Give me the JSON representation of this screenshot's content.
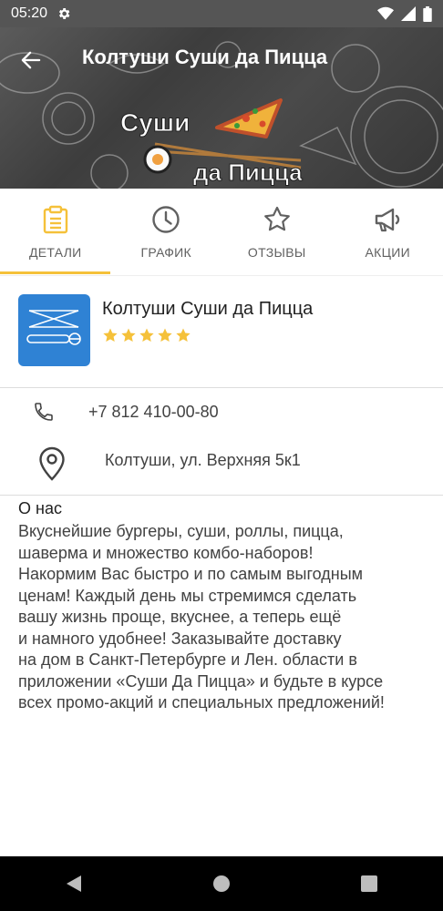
{
  "status_bar": {
    "time": "05:20"
  },
  "header": {
    "title": "Колтуши Суши да Пицца",
    "logo_line1": "Суши",
    "logo_line2": "да Пицца"
  },
  "tabs": [
    {
      "label": "ДЕТАЛИ",
      "icon": "clipboard-icon",
      "active": true
    },
    {
      "label": "ГРАФИК",
      "icon": "clock-icon",
      "active": false
    },
    {
      "label": "ОТЗЫВЫ",
      "icon": "star-outline-icon",
      "active": false
    },
    {
      "label": "АКЦИИ",
      "icon": "megaphone-icon",
      "active": false
    }
  ],
  "restaurant": {
    "name": "Колтуши Суши да Пицца",
    "rating": 5
  },
  "contacts": {
    "phone": "+7 812 410-00-80",
    "address": "Колтуши, ул. Верхняя 5к1"
  },
  "about": {
    "title": "О нас",
    "text": "Вкуснейшие бургеры, суши, роллы, пицца,\nшаверма и множество комбо-наборов!\nНакормим Вас быстро и по самым выгодным\nценам!  Каждый день мы стремимся сделать\nвашу жизнь проще, вкуснее, а теперь ещё\nи намного удобнее! Заказывайте доставку\nна дом в Санкт-Петербурге и Лен. области в\nприложении «Суши Да Пицца» и будьте в курсе\nвсех промо-акций и специальных предложений!"
  },
  "colors": {
    "accent": "#f5c13a",
    "app_icon": "#2f82d4",
    "status_bar": "#555555"
  }
}
